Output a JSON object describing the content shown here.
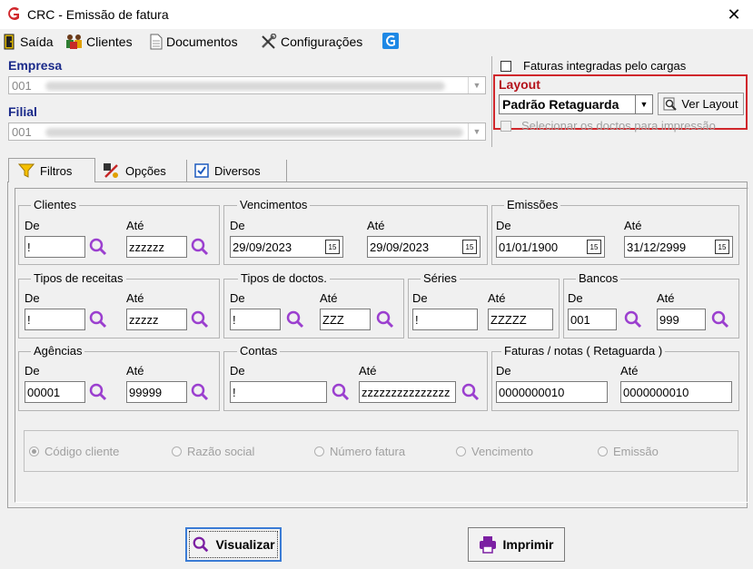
{
  "window": {
    "title": "CRC - Emissão de fatura",
    "close_glyph": "✕"
  },
  "menu": [
    {
      "label": "Saída",
      "icon": "exit-door-icon"
    },
    {
      "label": "Clientes",
      "icon": "users-icon"
    },
    {
      "label": "Documentos",
      "icon": "document-icon"
    },
    {
      "label": "Configurações",
      "icon": "tools-icon"
    }
  ],
  "empresa": {
    "label": "Empresa",
    "value": "001"
  },
  "filial": {
    "label": "Filial",
    "value": "001"
  },
  "faturas_integradas": {
    "label": "Faturas integradas pelo cargas",
    "checked": false
  },
  "layout": {
    "label": "Layout",
    "selected": "Padrão Retaguarda",
    "ver_layout": "Ver Layout"
  },
  "selecionar_doctos": {
    "label": "Selecionar os doctos para impressão",
    "checked": false
  },
  "tabs": [
    {
      "label": "Filtros",
      "icon": "filter-icon",
      "active": true
    },
    {
      "label": "Opções",
      "icon": "options-tools-icon",
      "active": false
    },
    {
      "label": "Diversos",
      "icon": "checkbox-icon",
      "active": false
    }
  ],
  "common": {
    "de": "De",
    "ate": "Até",
    "cal_glyph": "15"
  },
  "groups": {
    "clientes": {
      "title": "Clientes",
      "de": "!",
      "ate": "zzzzzz"
    },
    "vencimentos": {
      "title": "Vencimentos",
      "de": "29/09/2023",
      "ate": "29/09/2023"
    },
    "emissoes": {
      "title": "Emissões",
      "de": "01/01/1900",
      "ate": "31/12/2999"
    },
    "tipos_receitas": {
      "title": "Tipos de receitas",
      "de": "!",
      "ate": "zzzzz"
    },
    "tipos_doctos": {
      "title": "Tipos de doctos.",
      "de": "!",
      "ate": "ZZZ"
    },
    "series": {
      "title": "Séries",
      "de": "!",
      "ate": "ZZZZZ"
    },
    "bancos": {
      "title": "Bancos",
      "de": "001",
      "ate": "999"
    },
    "agencias": {
      "title": "Agências",
      "de": "00001",
      "ate": "99999"
    },
    "contas": {
      "title": "Contas",
      "de": "!",
      "ate": "zzzzzzzzzzzzzzz"
    },
    "faturas": {
      "title": "Faturas / notas ( Retaguarda )",
      "de": "0000000010",
      "ate": "0000000010"
    }
  },
  "order_options": [
    {
      "label": "Código cliente",
      "selected": true
    },
    {
      "label": "Razão social",
      "selected": false
    },
    {
      "label": "Número fatura",
      "selected": false
    },
    {
      "label": "Vencimento",
      "selected": false
    },
    {
      "label": "Emissão",
      "selected": false
    }
  ],
  "buttons": {
    "visualizar": "Visualizar",
    "imprimir": "Imprimir"
  },
  "colors": {
    "accent_red": "#d0262b",
    "label_blue": "#1a2a8a",
    "magnifier": "#9b3fcf",
    "focus_blue": "#3a7bd5"
  }
}
